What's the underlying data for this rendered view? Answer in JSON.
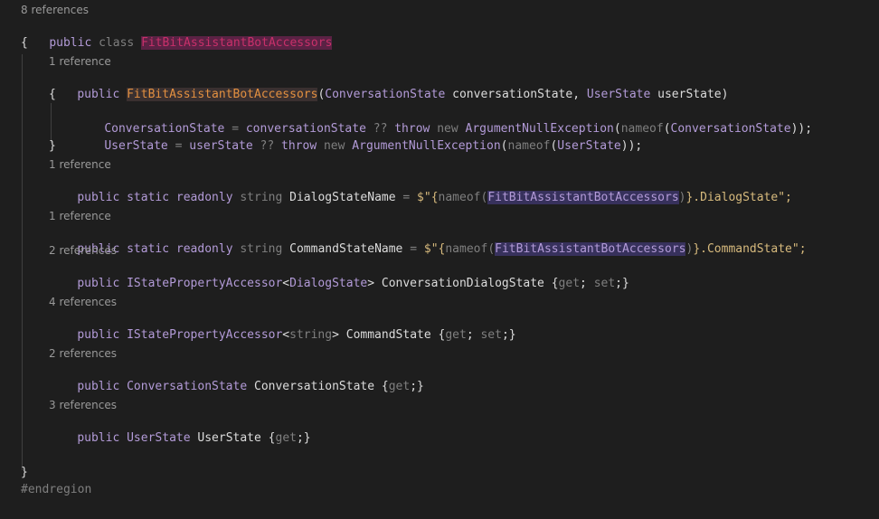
{
  "editor": {
    "language": "C#",
    "theme_background": "#1e1e1e",
    "code_lens": {
      "class_refs": "8 references",
      "ctor_refs": "1 reference",
      "dialog_name_refs": "1 reference",
      "command_name_refs": "1 reference",
      "dialog_accessor_refs": "2 references",
      "command_accessor_refs": "4 references",
      "conv_state_refs": "2 references",
      "user_state_refs": "3 references"
    },
    "code": {
      "public": "public",
      "class": "class",
      "static": "static",
      "readonly": "readonly",
      "string": "string",
      "class_name": "FitBitAssistantBotAccessors",
      "open_brace": "{",
      "close_brace": "}",
      "ctor_param1_type": "ConversationState",
      "ctor_param1_name": "conversationState",
      "ctor_param2_type": "UserState",
      "ctor_param2_name": "userState",
      "assign1_target": "ConversationState",
      "assign1_source": "conversationState",
      "assign2_target": "UserState",
      "assign2_source": "userState",
      "null_coalesce": "??",
      "throw": "throw",
      "new": "new",
      "exception_type": "ArgumentNullException",
      "nameof": "nameof",
      "dialog_state_field": "DialogStateName",
      "command_state_field": "CommandStateName",
      "dialog_suffix": "}.DialogState\";",
      "command_suffix": "}.CommandState\";",
      "interp_open": "$\"{",
      "accessor_type": "IStatePropertyAccessor",
      "dialog_state_type": "DialogState",
      "dialog_prop": "ConversationDialogState",
      "command_prop": "CommandState",
      "conv_state_type": "ConversationState",
      "conv_state_prop": "ConversationState",
      "user_state_type": "UserState",
      "user_state_prop": "UserState",
      "get": "get",
      "set": "set",
      "endregion": "#endregion"
    }
  }
}
